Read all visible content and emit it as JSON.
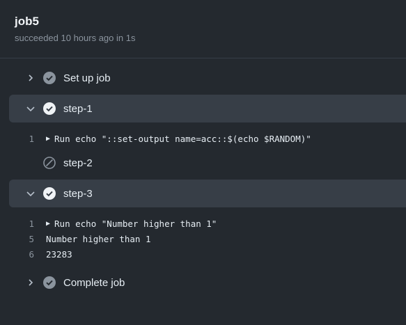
{
  "header": {
    "title": "job5",
    "subtitle": "succeeded 10 hours ago in 1s"
  },
  "colors": {
    "background": "#24292f",
    "expanded_row": "#373e47",
    "success_icon": "#8b949e",
    "muted_text": "#8b949e"
  },
  "steps": [
    {
      "label": "Set up job",
      "state": "collapsed",
      "status": "success"
    },
    {
      "label": "step-1",
      "state": "expanded",
      "status": "success",
      "log": [
        {
          "num": "1",
          "text": "Run echo \"::set-output name=acc::$(echo $RANDOM)\"",
          "group": true
        }
      ]
    },
    {
      "label": "step-2",
      "state": "none",
      "status": "skipped"
    },
    {
      "label": "step-3",
      "state": "expanded",
      "status": "success",
      "log": [
        {
          "num": "1",
          "text": "Run echo \"Number higher than 1\"",
          "group": true
        },
        {
          "num": "5",
          "text": "Number higher than 1",
          "group": false
        },
        {
          "num": "6",
          "text": "23283",
          "group": false
        }
      ]
    },
    {
      "label": "Complete job",
      "state": "collapsed",
      "status": "success"
    }
  ]
}
